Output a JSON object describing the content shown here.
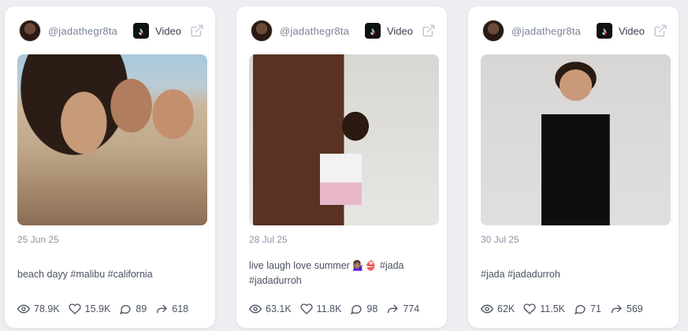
{
  "posts": [
    {
      "username": "@jadathegr8ta",
      "platform_label": "Video",
      "date": "25 Jun 25",
      "caption_lines": [
        "beach dayy #malibu #california"
      ],
      "views": "78.9K",
      "likes": "15.9K",
      "comments": "89",
      "shares": "618"
    },
    {
      "username": "@jadathegr8ta",
      "platform_label": "Video",
      "date": "28 Jul 25",
      "caption_lines": [
        "live laugh love summer 💁🏽‍♀️👙 #jada",
        "#jadadurroh"
      ],
      "views": "63.1K",
      "likes": "11.8K",
      "comments": "98",
      "shares": "774"
    },
    {
      "username": "@jadathegr8ta",
      "platform_label": "Video",
      "date": "30 Jul 25",
      "caption_lines": [
        "#jada #jadadurroh"
      ],
      "views": "62K",
      "likes": "11.5K",
      "comments": "71",
      "shares": "569"
    }
  ],
  "icons": {
    "platform": "tiktok-icon",
    "external": "external-link-icon",
    "views": "eye-icon",
    "likes": "heart-icon",
    "comments": "comment-icon",
    "shares": "share-icon"
  },
  "colors": {
    "background": "#eceef2",
    "card": "#ffffff",
    "muted_text": "#8a93a3",
    "body_text": "#4a5262"
  }
}
